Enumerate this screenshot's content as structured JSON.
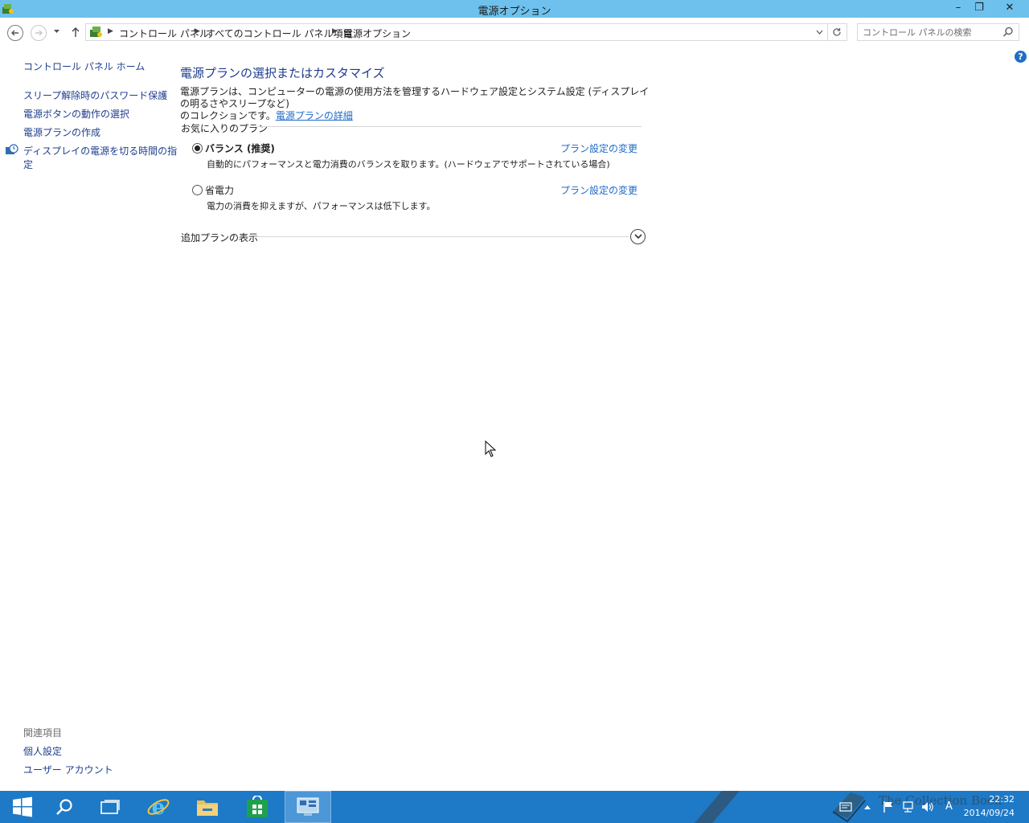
{
  "window": {
    "title": "電源オプション",
    "minimize": "–",
    "maximize": "❐",
    "close": "✕"
  },
  "address": {
    "crumbs": [
      "コントロール パネル",
      "すべてのコントロール パネル項目",
      "電源オプション"
    ],
    "search_placeholder": "コントロール パネルの検索"
  },
  "help_label": "?",
  "left_pane": {
    "home": "コントロール パネル ホーム",
    "links": [
      "スリープ解除時のパスワード保護",
      "電源ボタンの動作の選択",
      "電源プランの作成",
      "ディスプレイの電源を切る時間の指定"
    ],
    "display_link_line1": "ディスプレイの電源を切る時間の指",
    "display_link_line2": "定",
    "related": {
      "title": "関連項目",
      "links": [
        "個人設定",
        "ユーザー アカウント"
      ]
    }
  },
  "main": {
    "title": "電源プランの選択またはカスタマイズ",
    "desc_line1": "電源プランは、コンピューターの電源の使用方法を管理するハードウェア設定とシステム設定 (ディスプレイの明るさやスリープなど)",
    "desc_line2": "のコレクションです。",
    "desc_link": "電源プランの詳細",
    "favorites_label": "お気に入りのプラン",
    "plans": [
      {
        "name": "バランス (推奨)",
        "description": "自動的にパフォーマンスと電力消費のバランスを取ります。(ハードウェアでサポートされている場合)",
        "link": "プラン設定の変更",
        "selected": true
      },
      {
        "name": "省電力",
        "description": "電力の消費を抑えますが、パフォーマンスは低下します。",
        "link": "プラン設定の変更",
        "selected": false
      }
    ],
    "more_plans_label": "追加プランの表示"
  },
  "taskbar": {
    "items": [
      "start-button",
      "search-icon",
      "task-view-icon",
      "internet-explorer-icon",
      "file-explorer-icon",
      "store-icon",
      "control-panel-icon"
    ],
    "ime": "A",
    "time": "22:32",
    "date": "2014/09/24",
    "watermark": "The Collection Book"
  },
  "colors": {
    "titlebar": "#6ec1ec",
    "taskbar": "#1e79c7",
    "link": "#1e6ac9",
    "heading": "#1e3b8e"
  }
}
